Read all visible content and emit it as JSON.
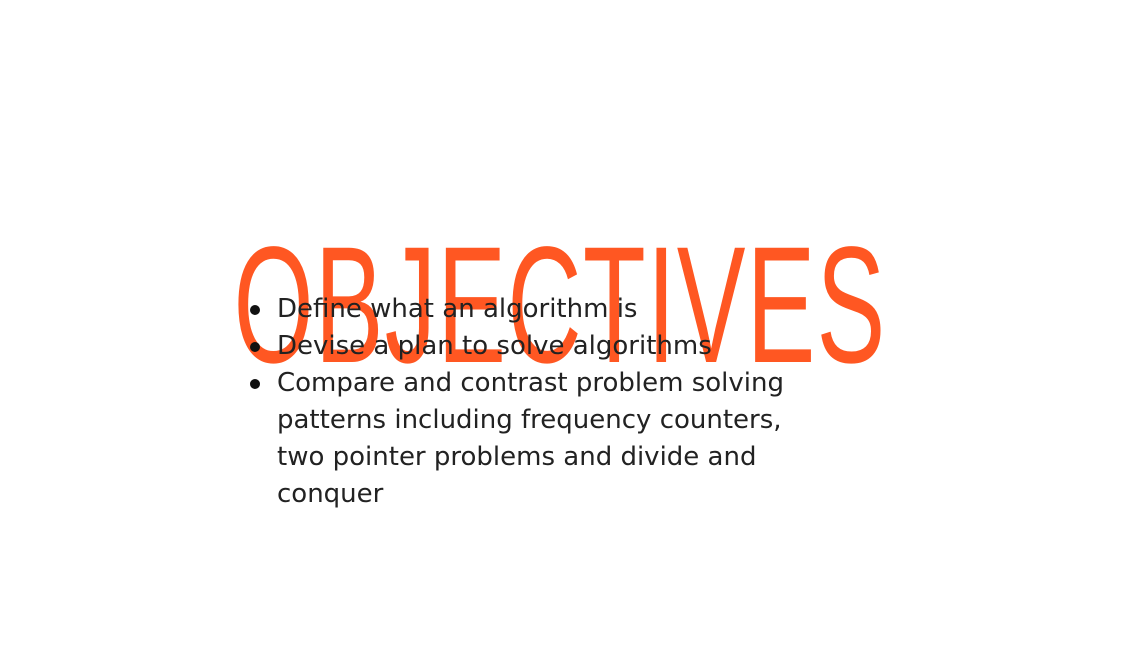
{
  "slide": {
    "title": "OBJECTIVES",
    "objectives": [
      "Define what an algorithm is",
      "Devise a plan to solve algorithms",
      "Compare and contrast problem solving patterns including frequency counters, two pointer problems and divide and conquer"
    ]
  },
  "colors": {
    "title": "#ff5722",
    "text": "#222222",
    "background": "#ffffff"
  }
}
